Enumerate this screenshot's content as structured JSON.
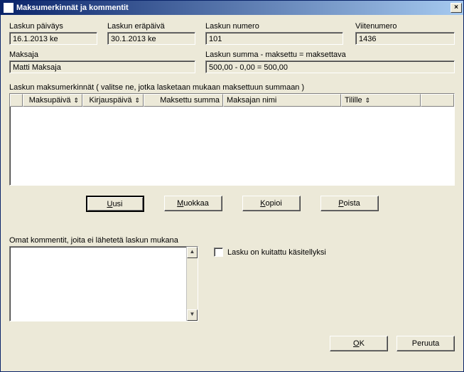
{
  "window": {
    "title": "Maksumerkinnät ja kommentit"
  },
  "fields": {
    "date_label": "Laskun päiväys",
    "date_value": "16.1.2013 ke",
    "due_label": "Laskun eräpäivä",
    "due_value": "30.1.2013 ke",
    "num_label": "Laskun numero",
    "num_value": "101",
    "ref_label": "Viitenumero",
    "ref_value": "1436",
    "payer_label": "Maksaja",
    "payer_value": "Matti Maksaja",
    "sum_label": "Laskun summa - maksettu = maksettava",
    "sum_value": "500,00 - 0,00 = 500,00"
  },
  "grid": {
    "caption": "Laskun maksumerkinnät ( valitse ne, jotka lasketaan mukaan maksettuun summaan )",
    "cols": {
      "paydate": "Maksupäivä",
      "bookdate": "Kirjauspäivä",
      "amount": "Maksettu summa",
      "payer": "Maksajan nimi",
      "account": "Tilille"
    }
  },
  "buttons": {
    "new": "Uusi",
    "edit": "Muokkaa",
    "copy": "Kopioi",
    "delete": "Poista",
    "ok": "OK",
    "cancel": "Peruuta"
  },
  "comments": {
    "label": "Omat kommentit, joita ei lähetetä laskun mukana"
  },
  "checkbox": {
    "label": "Lasku on kuitattu käsitellyksi",
    "checked": false
  }
}
